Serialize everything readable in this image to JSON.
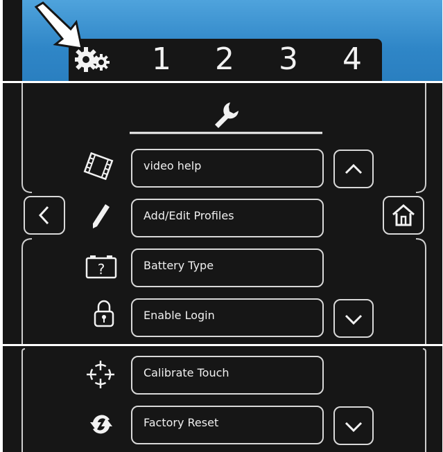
{
  "top_bar": {
    "tabs": [
      "1",
      "2",
      "3",
      "4"
    ],
    "background_color": "#2f86c7",
    "tab_strip_color": "#161616",
    "settings_icon": "gears-icon",
    "pointer_icon": "arrow-pointer-icon"
  },
  "settings_menu": {
    "header_icon": "wrench-icon",
    "back_icon": "chevron-left-icon",
    "home_icon": "home-icon",
    "scroll_up_icon": "chevron-up-icon",
    "scroll_down_icon": "chevron-down-icon",
    "items": [
      {
        "label": "video help",
        "icon": "film-icon"
      },
      {
        "label": "Add/Edit Profiles",
        "icon": "pencil-icon"
      },
      {
        "label": "Battery Type",
        "icon": "battery-question-icon"
      },
      {
        "label": "Enable Login",
        "icon": "padlock-icon"
      }
    ]
  },
  "settings_menu_scrolled": {
    "items": [
      {
        "label": "Calibrate Touch",
        "icon": "crosshair-icon"
      },
      {
        "label": "Factory Reset",
        "icon": "refresh-icon"
      }
    ]
  }
}
